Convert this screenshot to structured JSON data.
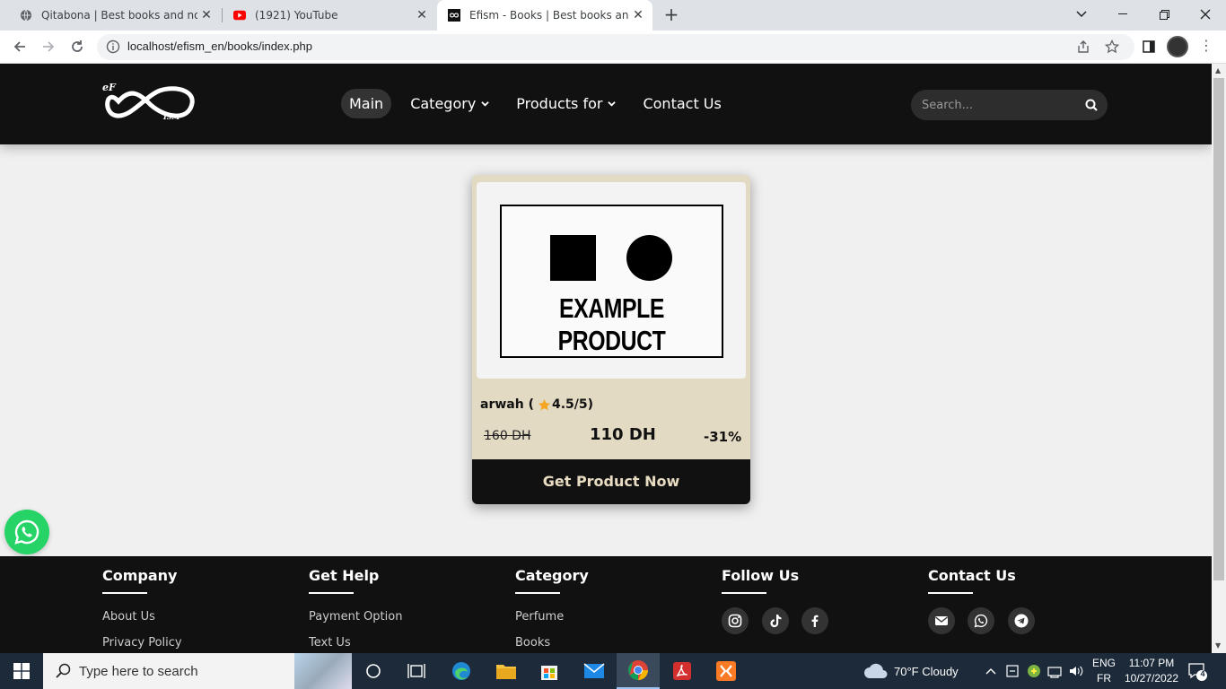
{
  "browser": {
    "tabs": [
      {
        "title": "Qitabona | Best books and novels",
        "favicon": "globe-icon"
      },
      {
        "title": "(1921) YouTube",
        "favicon": "youtube-icon"
      },
      {
        "title": "Efism - Books | Best books and novels",
        "favicon": "efism-icon",
        "active": true
      }
    ],
    "url": "localhost/efism_en/books/index.php"
  },
  "header": {
    "menu": [
      {
        "label": "Main",
        "active": true
      },
      {
        "label": "Category",
        "dropdown": true
      },
      {
        "label": "Products for",
        "dropdown": true
      },
      {
        "label": "Contact Us"
      }
    ],
    "search_placeholder": "Search..."
  },
  "product": {
    "image_text": "EXAMPLE PRODUCT",
    "name": "arwah (",
    "rating": "4.5/5",
    "rating_close": " )",
    "old_price": "160 DH",
    "new_price": "110 DH",
    "discount": "-31%",
    "button": "Get Product Now"
  },
  "footer": {
    "columns": [
      {
        "title": "Company",
        "links": [
          "About Us",
          "Privacy Policy"
        ]
      },
      {
        "title": "Get Help",
        "links": [
          "Payment Option",
          "Text Us"
        ]
      },
      {
        "title": "Category",
        "links": [
          "Perfume",
          "Books"
        ]
      },
      {
        "title": "Follow Us",
        "icons": [
          "instagram-icon",
          "tiktok-icon",
          "facebook-icon"
        ]
      },
      {
        "title": "Contact Us",
        "icons": [
          "mail-icon",
          "whatsapp-icon",
          "telegram-icon"
        ]
      }
    ]
  },
  "taskbar": {
    "search_placeholder": "Type here to search",
    "weather": "70°F  Cloudy",
    "lang_top": "ENG",
    "lang_bottom": "FR",
    "time": "11:07 PM",
    "date": "10/27/2022",
    "notifications": "4"
  },
  "colors": {
    "header_bg": "#111111",
    "card_bg": "#e3dac4",
    "accent_star": "#f5a623",
    "whatsapp": "#25d366"
  }
}
